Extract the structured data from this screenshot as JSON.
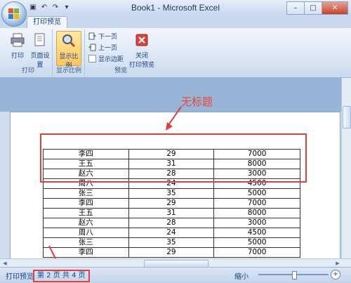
{
  "window": {
    "title": "Book1 - Microsoft Excel"
  },
  "ribbon": {
    "tab_label": "打印预览",
    "groups": {
      "print": {
        "label": "打印",
        "print_btn": "打印",
        "page_setup_btn": "页面设置"
      },
      "zoom": {
        "label": "显示比例",
        "zoom_btn": "显示比例"
      },
      "preview": {
        "label": "预览",
        "next_page": "下一页",
        "prev_page": "上一页",
        "show_margins": "显示边距",
        "close_btn_line1": "关闭",
        "close_btn_line2": "打印预览"
      }
    }
  },
  "annotation": {
    "text": "无标题"
  },
  "table": {
    "rows": [
      [
        "李四",
        "29",
        "7000"
      ],
      [
        "王五",
        "31",
        "8000"
      ],
      [
        "赵六",
        "28",
        "3000"
      ],
      [
        "周八",
        "24",
        "4500"
      ],
      [
        "张三",
        "35",
        "5000"
      ],
      [
        "李四",
        "29",
        "7000"
      ],
      [
        "王五",
        "31",
        "8000"
      ],
      [
        "赵六",
        "28",
        "3000"
      ],
      [
        "周八",
        "24",
        "4500"
      ],
      [
        "张三",
        "35",
        "5000"
      ],
      [
        "李四",
        "29",
        "7000"
      ]
    ]
  },
  "status": {
    "mode": "打印预览",
    "page_info": "第 2 页  共 4 页",
    "zoom_label": "缩小"
  },
  "colors": {
    "annotation_red": "#e0403a",
    "ribbon_blue": "#15428b"
  }
}
